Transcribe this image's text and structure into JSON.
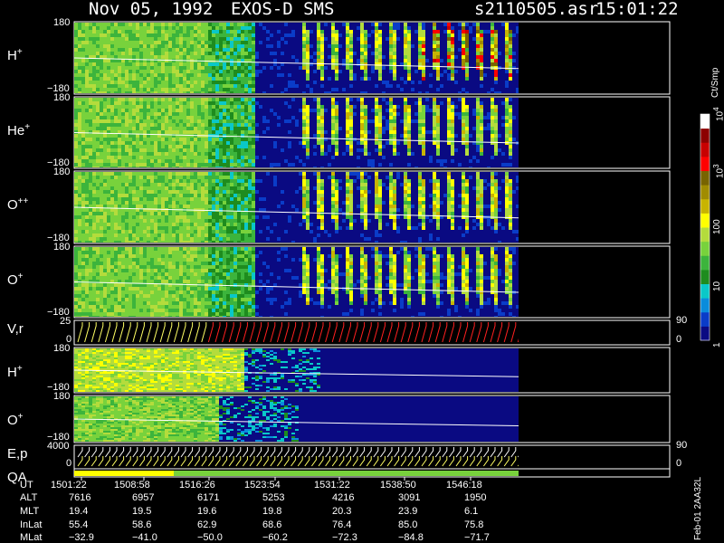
{
  "title": {
    "date": "Nov 05, 1992",
    "instrument": "EXOS-D SMS",
    "file": "s2110505.asr",
    "time": "15:01:22"
  },
  "chart_data": {
    "type": "heatmap",
    "panels": [
      {
        "id": "h_plus_top",
        "label_base": "H",
        "label_sup": "+",
        "ymax_label": "180",
        "ymin_label": "−180",
        "kind": "spectrogram",
        "profile": "top"
      },
      {
        "id": "he_plus",
        "label_base": "He",
        "label_sup": "+",
        "ymax_label": "180",
        "ymin_label": "−180",
        "kind": "spectrogram",
        "profile": "mid"
      },
      {
        "id": "o_plusplus",
        "label_base": "O",
        "label_sup": "++",
        "ymax_label": "180",
        "ymin_label": "−180",
        "kind": "spectrogram",
        "profile": "mid"
      },
      {
        "id": "o_plus_top",
        "label_base": "O",
        "label_sup": "+",
        "ymax_label": "180",
        "ymin_label": "−180",
        "kind": "spectrogram",
        "profile": "mid"
      },
      {
        "id": "v_r",
        "label_base": "V,r",
        "label_sup": "",
        "ymax_label": "25",
        "ymin_label": "0",
        "right_top_label": "90",
        "right_bottom_label": "0",
        "kind": "sawtooth"
      },
      {
        "id": "h_plus_low",
        "label_base": "H",
        "label_sup": "+",
        "ymax_label": "180",
        "ymin_label": "−180",
        "kind": "spectrogram",
        "profile": "low"
      },
      {
        "id": "o_plus_low",
        "label_base": "O",
        "label_sup": "+",
        "ymax_label": "180",
        "ymin_label": "−180",
        "kind": "spectrogram",
        "profile": "low2"
      },
      {
        "id": "e_p",
        "label_base": "E,p",
        "label_sup": "",
        "ymax_label": "4000",
        "ymin_label": "0",
        "right_top_label": "90",
        "right_bottom_label": "0",
        "kind": "sawtooth2"
      },
      {
        "id": "qa",
        "label_base": "QA",
        "label_sup": "",
        "kind": "qa"
      }
    ],
    "colorbar": {
      "unit_label": "Ct/Smp",
      "tick_labels": [
        "1",
        "10",
        "100",
        "10",
        "10"
      ],
      "tick_exponents": [
        "",
        "",
        "",
        "3",
        "4"
      ],
      "scale": "log",
      "range": [
        1,
        10000
      ],
      "colors": [
        "#0a0a82",
        "#0a3cc8",
        "#0a8cdc",
        "#0ac8c8",
        "#1e8c1e",
        "#3cb43c",
        "#78d23c",
        "#b4dc3c",
        "#ffff00",
        "#c8b400",
        "#a08c00",
        "#786400",
        "#ff0000",
        "#c80000",
        "#8c0000",
        "#ffffff"
      ]
    },
    "time_axis": {
      "rows": [
        {
          "name": "UT",
          "values": [
            "1501:22",
            "1508:58",
            "1516:26",
            "1523:54",
            "1531:22",
            "1538:50",
            "1546:18"
          ]
        },
        {
          "name": "ALT",
          "values": [
            "7616",
            "6957",
            "6171",
            "5253",
            "4216",
            "3091",
            "1950"
          ]
        },
        {
          "name": "MLT",
          "values": [
            "19.4",
            "19.5",
            "19.6",
            "19.8",
            "20.3",
            "23.9",
            "6.1"
          ]
        },
        {
          "name": "InLat",
          "values": [
            "55.4",
            "58.6",
            "62.9",
            "68.6",
            "76.4",
            "85.0",
            "75.8"
          ]
        },
        {
          "name": "MLat",
          "values": [
            "−32.9",
            "−41.0",
            "−50.0",
            "−60.2",
            "−72.3",
            "−84.8",
            "−71.7"
          ]
        }
      ]
    },
    "footer_label": "Feb-01 2AA32L"
  }
}
